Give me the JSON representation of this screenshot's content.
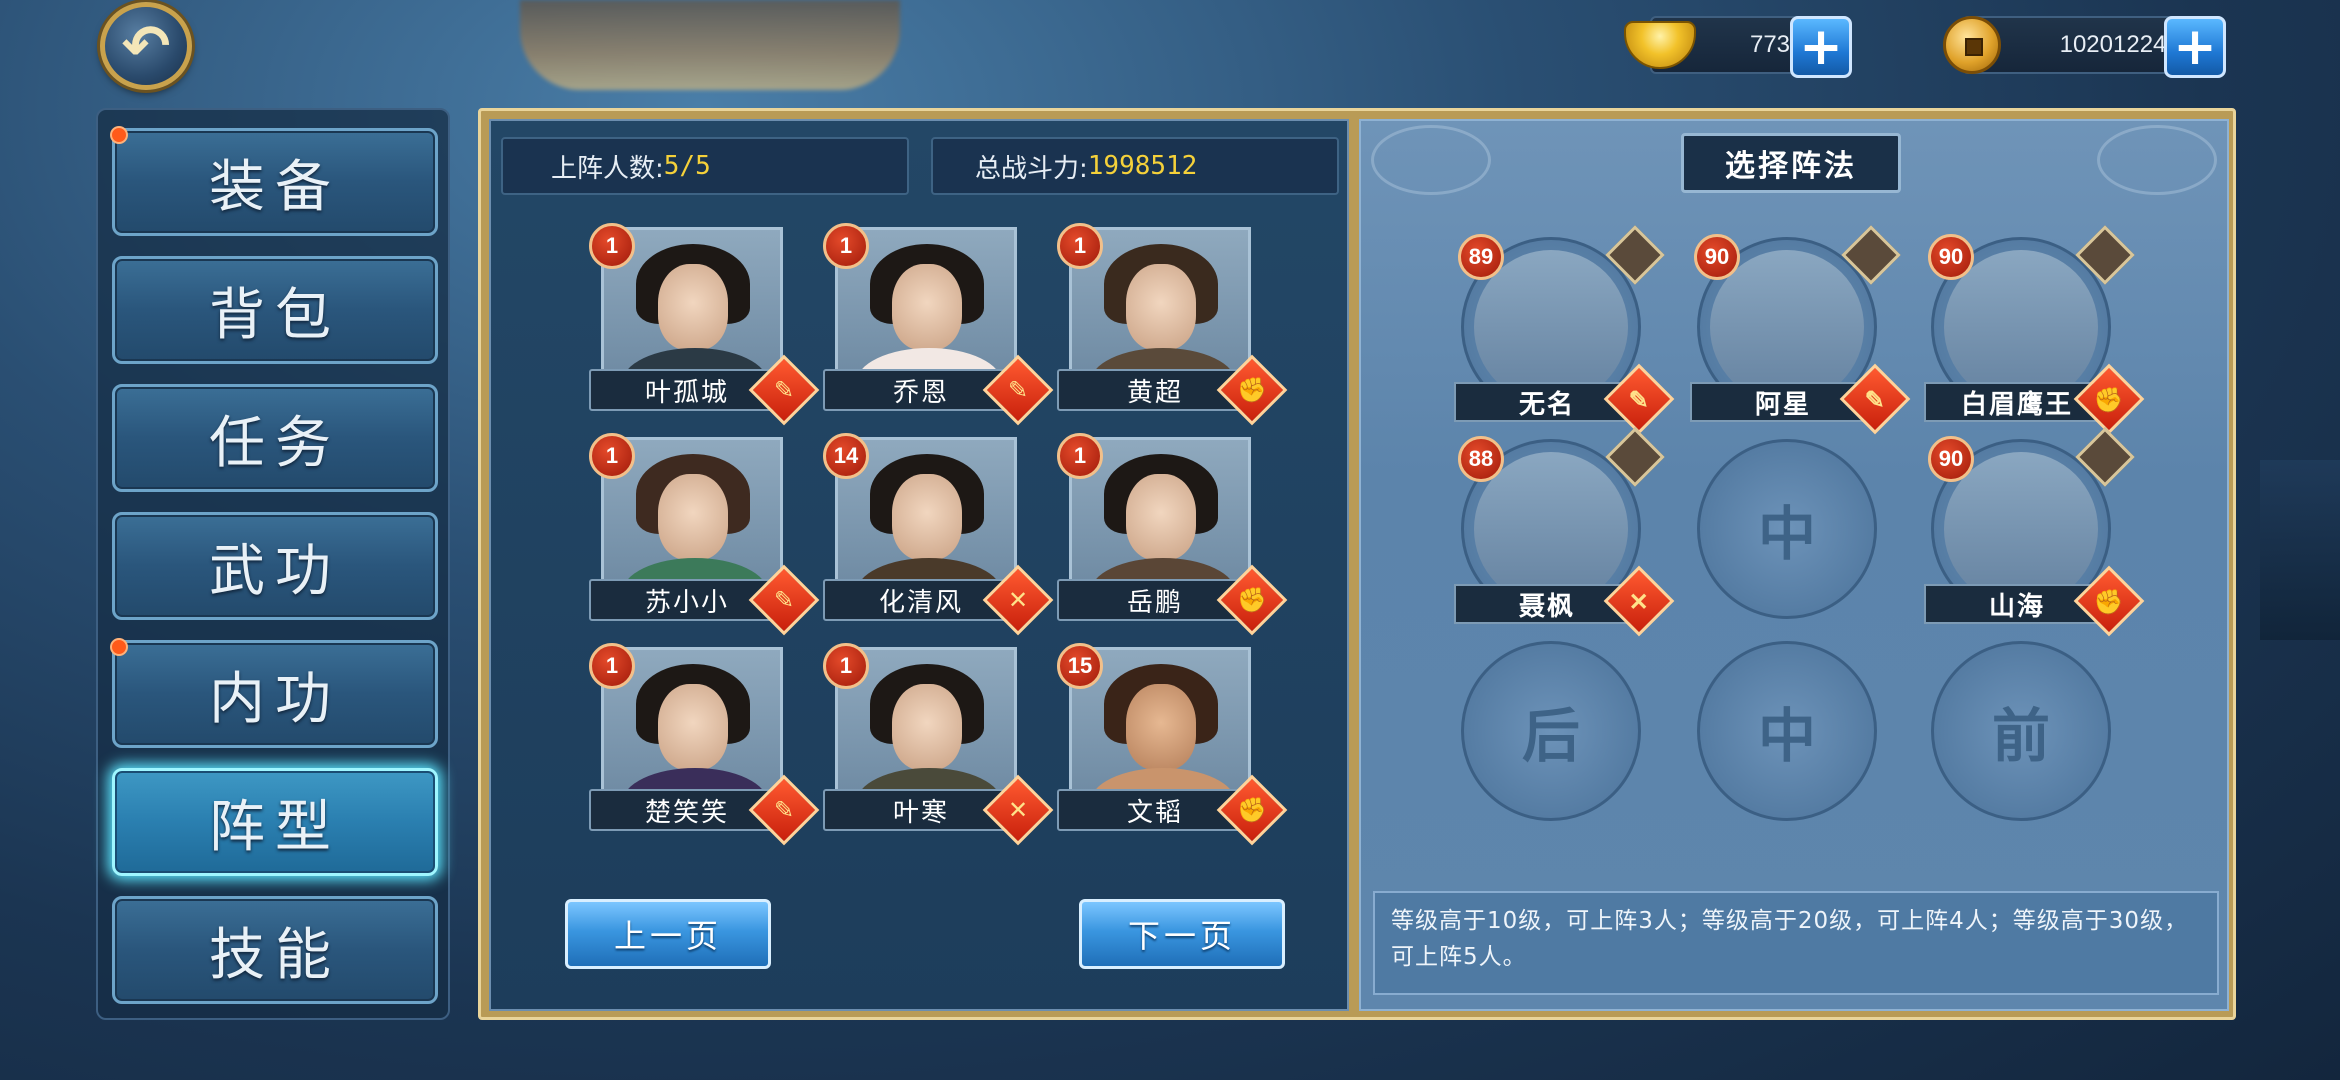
{
  "currency": {
    "gold": "773",
    "coins": "10201224"
  },
  "menu": [
    {
      "label": "装备",
      "dot": true,
      "active": false
    },
    {
      "label": "背包",
      "dot": false,
      "active": false
    },
    {
      "label": "任务",
      "dot": false,
      "active": false
    },
    {
      "label": "武功",
      "dot": false,
      "active": false
    },
    {
      "label": "内功",
      "dot": true,
      "active": false
    },
    {
      "label": "阵型",
      "dot": false,
      "active": true
    },
    {
      "label": "技能",
      "dot": false,
      "active": false
    }
  ],
  "stats": {
    "deployed_label": "上阵人数:",
    "deployed_value": "5/5",
    "power_label": "总战斗力:",
    "power_value": "1998512"
  },
  "heroes": [
    {
      "name": "叶孤城",
      "level": "1",
      "role": "sword"
    },
    {
      "name": "乔恩",
      "level": "1",
      "role": "sword"
    },
    {
      "name": "黄超",
      "level": "1",
      "role": "fist"
    },
    {
      "name": "苏小小",
      "level": "1",
      "role": "sword"
    },
    {
      "name": "化清风",
      "level": "14",
      "role": "cross"
    },
    {
      "name": "岳鹏",
      "level": "1",
      "role": "fist"
    },
    {
      "name": "楚笑笑",
      "level": "1",
      "role": "sword"
    },
    {
      "name": "叶寒",
      "level": "1",
      "role": "cross"
    },
    {
      "name": "文韬",
      "level": "15",
      "role": "fist"
    }
  ],
  "pager": {
    "prev": "上一页",
    "next": "下一页"
  },
  "formation": {
    "title": "选择阵法",
    "placed": [
      {
        "name": "无名",
        "level": "89",
        "role": "sword"
      },
      {
        "name": "阿星",
        "level": "90",
        "role": "sword"
      },
      {
        "name": "白眉鹰王",
        "level": "90",
        "role": "fist"
      },
      {
        "name": "聂枫",
        "level": "88",
        "role": "cross"
      },
      {
        "name": "山海",
        "level": "90",
        "role": "fist"
      }
    ],
    "empty_slots": [
      "中",
      "后",
      "中",
      "前"
    ],
    "tip": "等级高于10级，可上阵3人；等级高于20级，可上阵4人；等级高于30级，可上阵5人。"
  }
}
